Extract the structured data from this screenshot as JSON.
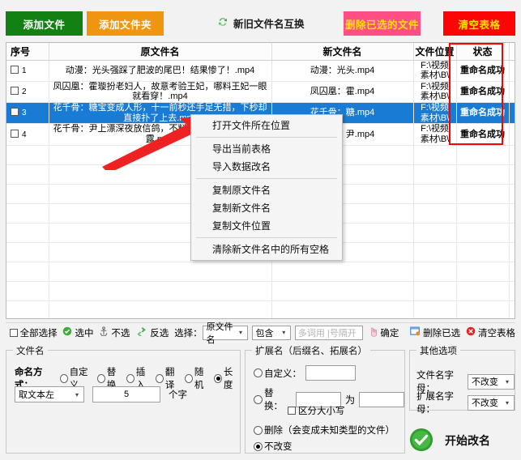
{
  "toolbar": {
    "add_file": "添加文件",
    "add_folder": "添加文件夹",
    "swap": "新旧文件名互换",
    "delete_selected_files": "删除已选的文件",
    "clear_table": "清空表格"
  },
  "table": {
    "headers": {
      "index": "序号",
      "old_name": "原文件名",
      "new_name": "新文件名",
      "location": "文件位置",
      "status": "状态"
    },
    "rows": [
      {
        "index": "1",
        "old_name": "动漫：光头强踩了肥波的尾巴！结果惨了！.mp4",
        "new_name": "动漫：光头.mp4",
        "location": "F:\\视频素材\\B\\",
        "status": "重命名成功",
        "selected": false
      },
      {
        "index": "2",
        "old_name": "凤囚凰：霍璇扮老妇人，故意考验王妃，哪料王妃一眼就看穿！.mp4",
        "new_name": "凤囚凰：霍.mp4",
        "location": "F:\\视频素材\\B\\",
        "status": "重命名成功",
        "selected": false
      },
      {
        "index": "3",
        "old_name": "花千骨：糖宝变成人形，十一前秒还手足无措，下秒却直接扑了上去.mp4",
        "new_name": "花千骨：糖.mp4",
        "location": "F:\\视频素材\\B\\",
        "status": "重命名成功",
        "selected": true
      },
      {
        "index": "4",
        "old_name": "花千骨：尹上漂深夜放信鸽，不料被花千骨发现身份暴露.mp4",
        "new_name": "花千骨：尹.mp4",
        "location": "F:\\视频素材\\B\\",
        "status": "重命名成功",
        "selected": false
      }
    ],
    "empty_row_count": 9
  },
  "context_menu": {
    "items": [
      {
        "label": "打开文件所在位置",
        "separator_after": true
      },
      {
        "label": "导出当前表格",
        "separator_after": false
      },
      {
        "label": "导入数据改名",
        "separator_after": true
      },
      {
        "label": "复制原文件名",
        "separator_after": false
      },
      {
        "label": "复制新文件名",
        "separator_after": false
      },
      {
        "label": "复制文件位置",
        "separator_after": true
      },
      {
        "label": "清除新文件名中的所有空格",
        "separator_after": false
      }
    ]
  },
  "select_bar": {
    "select_all": "全部选择",
    "check": "选中",
    "uncheck": "不选",
    "invert": "反选",
    "select_label": "选择：",
    "field_value": "原文件名",
    "match_value": "包含",
    "keyword_placeholder": "多词用 |号隔开",
    "keyword_value": "",
    "confirm": "确定",
    "delete_selected": "删除已选",
    "clear_table": "清空表格"
  },
  "filename_panel": {
    "caption": "文件名",
    "mode_label": "命名方式：",
    "modes": [
      {
        "label": "自定义",
        "checked": false
      },
      {
        "label": "替换",
        "checked": false
      },
      {
        "label": "插入",
        "checked": false
      },
      {
        "label": "翻译",
        "checked": false
      },
      {
        "label": "随机",
        "checked": false
      },
      {
        "label": "长度",
        "checked": true
      }
    ],
    "take_mode": "取文本左",
    "length_value": "5",
    "unit": "个字"
  },
  "ext_panel": {
    "caption": "扩展名（后缀名、拓展名）",
    "custom_label": "自定义：",
    "custom_value": "",
    "custom_checked": false,
    "replace_label": "替换：",
    "replace_from": "",
    "replace_to": "",
    "replace_mid": "为",
    "replace_checked": false,
    "case_sensitive_label": "区分大小写",
    "case_sensitive_checked": false,
    "delete_label": "删除（会变成未知类型的文件）",
    "delete_checked": false,
    "nochange_label": "不改变",
    "nochange_checked": true
  },
  "other_panel": {
    "caption": "其他选项",
    "filename_case_label": "文件名字母：",
    "filename_case_value": "不改变",
    "ext_case_label": "扩展名字母：",
    "ext_case_value": "不改变"
  },
  "start": {
    "label": "开始改名"
  },
  "colors": {
    "green": "#128012",
    "orange": "#f0950f",
    "pink": "#ff4d86",
    "red": "#fb0505",
    "yellow_text": "#ffe500",
    "selection_blue": "#1a7bd4",
    "annotation_red": "#ff0000"
  }
}
